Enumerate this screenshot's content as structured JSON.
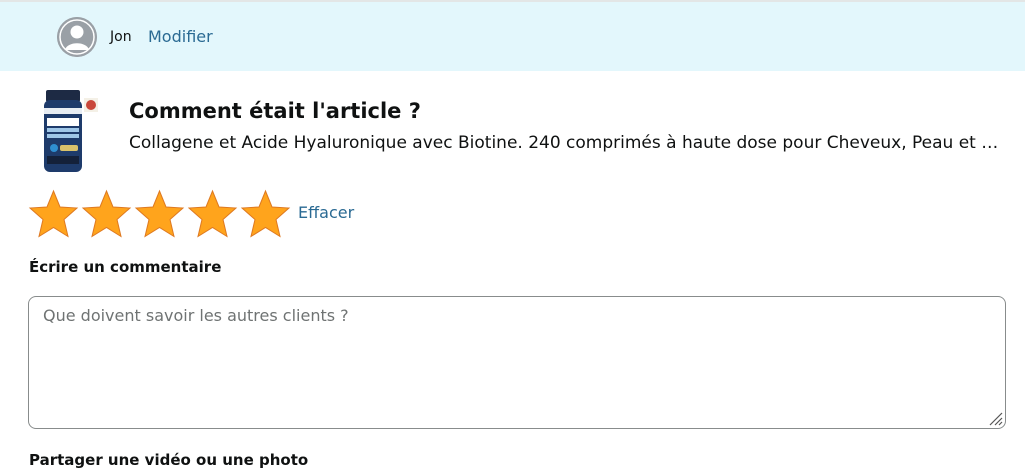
{
  "header": {
    "user_name": "Jon",
    "edit_label": "Modifier",
    "background_color": "#e3f7fc"
  },
  "product": {
    "image_icon": "product-bottle-icon",
    "question": "Comment était l'article ?",
    "name": "Collagene et Acide Hyaluronique avec Biotine. 240 comprimés à haute dose pour Cheveux, Peau et Ongles"
  },
  "rating": {
    "value": 5,
    "max": 5,
    "star_color": "#ffa41c",
    "clear_label": "Effacer"
  },
  "review": {
    "label": "Écrire un commentaire",
    "placeholder": "Que doivent savoir les autres clients ?",
    "value": ""
  },
  "media": {
    "label": "Partager une vidéo ou une photo"
  },
  "colors": {
    "link": "#2a6a93",
    "text": "#0f1111"
  }
}
